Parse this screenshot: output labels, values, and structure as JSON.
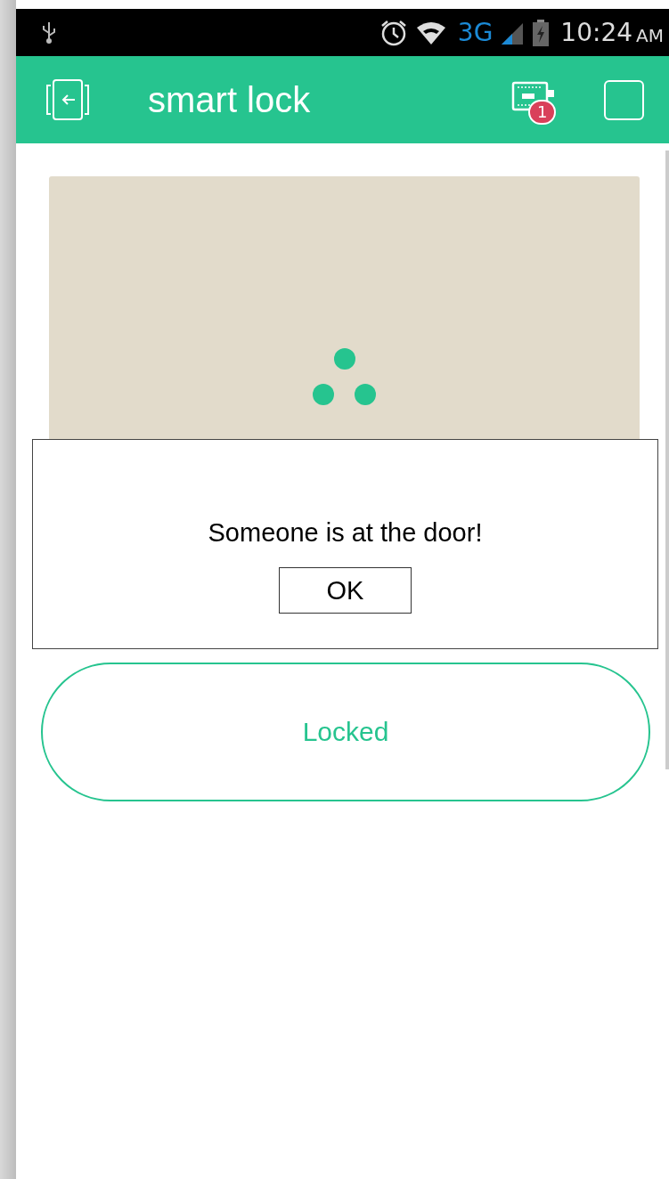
{
  "status_bar": {
    "network": "3G",
    "time": "10:24",
    "meridiem": "AM"
  },
  "app_bar": {
    "title": "smart lock",
    "notification_count": "1"
  },
  "lock_button": {
    "label": "Locked"
  },
  "dialog": {
    "message": "Someone is at the door!",
    "button": "OK"
  }
}
